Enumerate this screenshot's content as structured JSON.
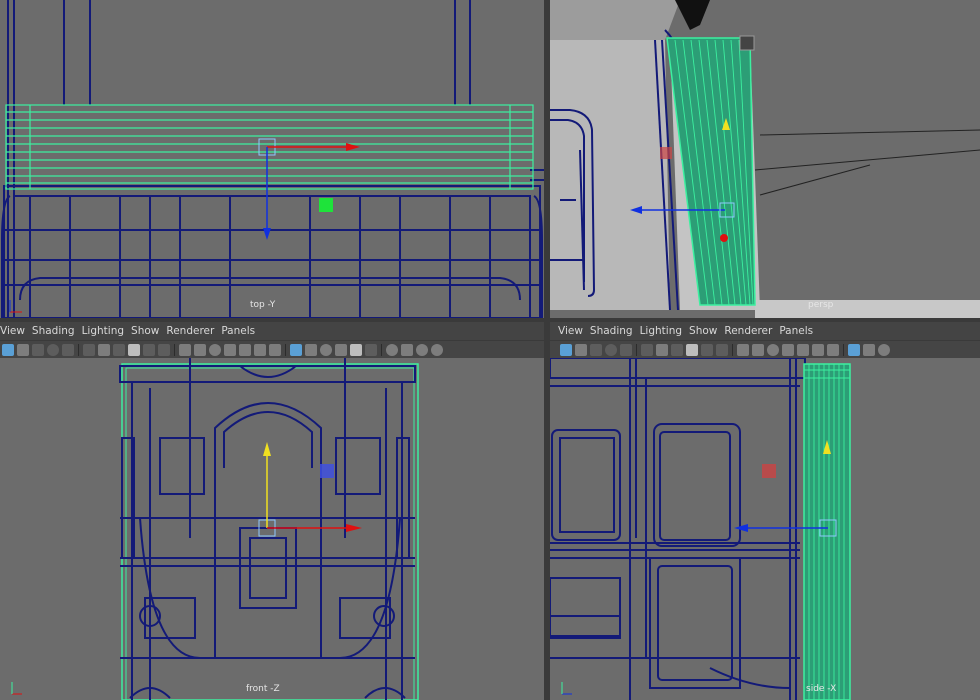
{
  "panels": {
    "top_left": {
      "camera_label": "top -Y"
    },
    "top_right": {
      "camera_label": "persp"
    },
    "bottom_left": {
      "camera_label": "front -Z",
      "menu": [
        "View",
        "Shading",
        "Lighting",
        "Show",
        "Renderer",
        "Panels"
      ]
    },
    "bottom_right": {
      "camera_label": "side -X",
      "menu": [
        "View",
        "Shading",
        "Lighting",
        "Show",
        "Renderer",
        "Panels"
      ]
    }
  },
  "axis_labels": {
    "y": "y",
    "z": "z"
  },
  "colors": {
    "viewport_bg": "#6c6c6c",
    "wire_dark": "#131a78",
    "wire_selected": "#3cf0a0",
    "manip_x": "#e01010",
    "manip_y": "#f0e020",
    "manip_z": "#1030e0"
  }
}
